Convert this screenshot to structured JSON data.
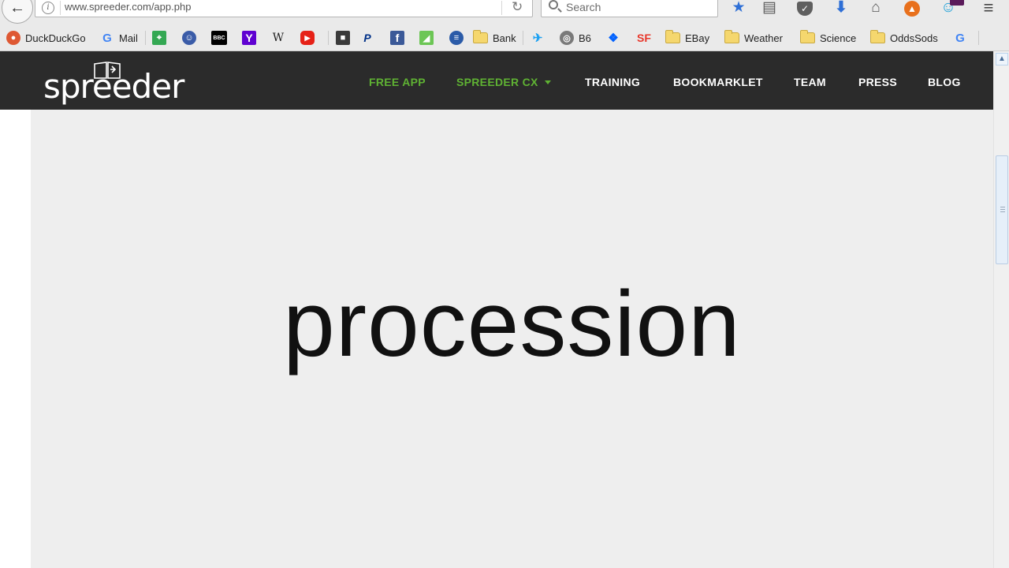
{
  "browser": {
    "url": "www.spreeder.com/app.php",
    "search_placeholder": "Search",
    "bookmarks": [
      {
        "label": "DuckDuckGo",
        "icon": "duckduckgo-icon",
        "color": "#de5833"
      },
      {
        "label": "Mail",
        "icon": "google-icon",
        "color": "#4285f4"
      },
      {
        "label": "",
        "icon": "google-maps-icon",
        "color": "#34a853"
      },
      {
        "label": "",
        "icon": "ancestry-icon",
        "color": "#3b5ca8"
      },
      {
        "label": "",
        "icon": "bbc-icon",
        "color": "#000000"
      },
      {
        "label": "",
        "icon": "yahoo-icon",
        "color": "#5f01d1"
      },
      {
        "label": "",
        "icon": "wikipedia-icon",
        "color": "#222222"
      },
      {
        "label": "",
        "icon": "youtube-icon",
        "color": "#e62117"
      },
      {
        "label": "",
        "icon": "shopping-icon",
        "color": "#3a3a3a"
      },
      {
        "label": "",
        "icon": "paypal-icon",
        "color": "#003087"
      },
      {
        "label": "",
        "icon": "facebook-icon",
        "color": "#3b5998"
      },
      {
        "label": "",
        "icon": "feedly-icon",
        "color": "#6cc655"
      },
      {
        "label": "",
        "icon": "stumble-icon",
        "color": "#2b5ba8"
      },
      {
        "label": "Bank",
        "icon": "folder-icon"
      },
      {
        "label": "",
        "icon": "twitter-icon",
        "color": "#1da1f2"
      },
      {
        "label": "B6",
        "icon": "globe-icon",
        "color": "#7a7a7a"
      },
      {
        "label": "",
        "icon": "dropbox-icon",
        "color": "#0061fe"
      },
      {
        "label": "",
        "icon": "sourceforge-icon",
        "color": "#e8372b"
      },
      {
        "label": "EBay",
        "icon": "folder-icon"
      },
      {
        "label": "Weather",
        "icon": "folder-icon"
      },
      {
        "label": "Science",
        "icon": "folder-icon"
      },
      {
        "label": "OddsSods",
        "icon": "folder-icon"
      },
      {
        "label": "",
        "icon": "google-icon",
        "color": "#4285f4"
      }
    ]
  },
  "site": {
    "logo_text": "spreeder",
    "nav": [
      {
        "label": "FREE APP",
        "highlight": true
      },
      {
        "label": "SPREEDER CX",
        "highlight": true,
        "dropdown": true
      },
      {
        "label": "TRAINING"
      },
      {
        "label": "BOOKMARKLET"
      },
      {
        "label": "TEAM"
      },
      {
        "label": "PRESS"
      },
      {
        "label": "BLOG"
      }
    ],
    "accent_color": "#5fb233",
    "header_color": "#2b2b2b"
  },
  "reader": {
    "current_word": "procession"
  }
}
